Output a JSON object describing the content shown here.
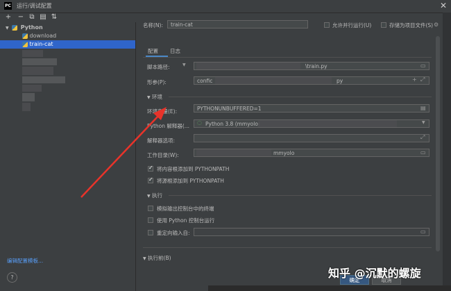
{
  "window": {
    "title": "运行/调试配置",
    "logo": "PC"
  },
  "toolbar": {
    "add": "+",
    "remove": "−",
    "copy": "⧉",
    "folder": "▤",
    "sort": "⇅"
  },
  "tree": {
    "group_label": "Python",
    "items": [
      {
        "label": "download"
      },
      {
        "label": "train-cat"
      }
    ]
  },
  "sidebar_footer": {
    "edit_templates": "编辑配置模板...",
    "help": "?"
  },
  "header": {
    "name_label": "名称(N):",
    "name_value": "train-cat",
    "parallel_label": "允许并行运行(U)",
    "store_label": "存储为项目文件(S)"
  },
  "tabs": {
    "config": "配置",
    "logs": "日志"
  },
  "form": {
    "script_path_label": "脚本路径:",
    "script_path_value": "\\train.py",
    "params_label": "形参(P):",
    "params_value_prefix": "confic",
    "params_value_suffix": "py",
    "env_section": "环境",
    "env_vars_label": "环境变量(E):",
    "env_vars_value": "PYTHONUNBUFFERED=1",
    "interpreter_label": "Python 解释器(...",
    "interpreter_value": "Python 3.8 (mmyolo)",
    "interp_options_label": "解释器选项:",
    "workdir_label": "工作目录(W):",
    "workdir_value": "mmyolo",
    "add_content_roots": "将内容根添加到 PYTHONPATH",
    "add_source_roots": "将源根添加到 PYTHONPATH",
    "exec_section": "执行",
    "emulate_terminal": "模拟输出控制台中的终端",
    "python_console": "使用 Python 控制台运行",
    "redirect_input": "重定向输入自:",
    "before_launch": "执行前(B)"
  },
  "buttons": {
    "ok": "确定",
    "cancel": "取消"
  },
  "watermark": "知乎 @沉默的螺旋",
  "colors": {
    "accent": "#2f65ca",
    "arrow": "#e8332a",
    "link": "#589df6"
  }
}
